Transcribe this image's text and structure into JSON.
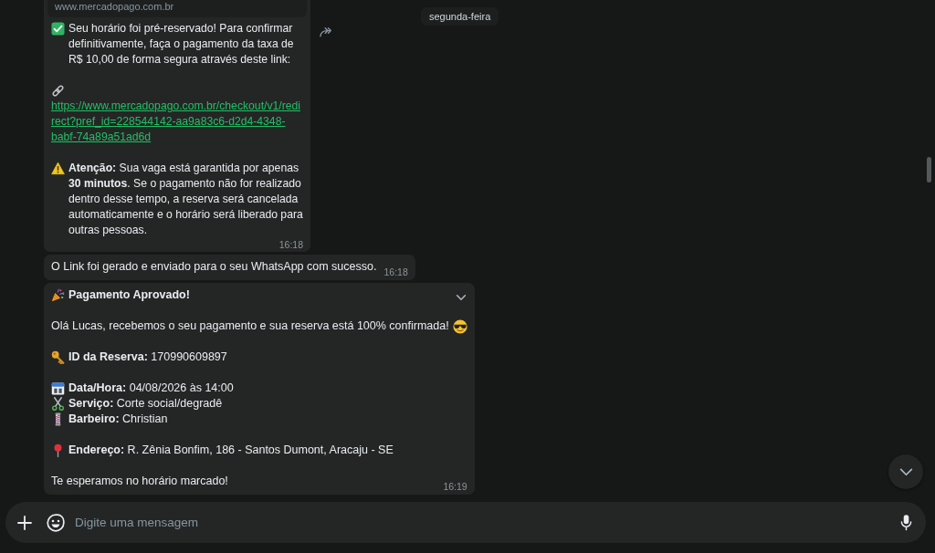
{
  "date_chip": {
    "label": "segunda-feira"
  },
  "messages": [
    {
      "kind": "link_preview",
      "hovered": false,
      "preview": {
        "domain": "www.mercadopago.com.br"
      },
      "paragraphs": [
        [
          {
            "kind": "confirmed",
            "text": "Seu horário foi pré-reservado! Para confirmar definitivamente, faça o pagamento da taxa de R$ 10,00 de forma segura através deste link:"
          }
        ],
        [
          {
            "kind": "link",
            "text": "https://www.mercadopago.com.br/checkout/v1/redirect?pref_id=228544142-aa9a83c6-d2d4-4348-babf-74a89a51ad6d"
          }
        ],
        [
          {
            "kind": "warning",
            "text": "**Atenção:** Sua vaga está garantida por apenas **30 minutos**. Se o pagamento não for realizado dentro desse tempo, a reserva será cancelada automaticamente e o horário será liberado para outras pessoas."
          }
        ]
      ],
      "time": "16:18"
    },
    {
      "kind": "text",
      "hovered": false,
      "paragraphs": [
        [
          {
            "kind": "text",
            "text": "O Link foi gerado e enviado para o seu WhatsApp com sucesso."
          }
        ]
      ],
      "time": "16:18"
    },
    {
      "kind": "text",
      "hovered": true,
      "paragraphs": [
        [
          {
            "kind": "heading",
            "text": "Pagamento Aprovado!"
          }
        ],
        [
          {
            "kind": "greeting",
            "text": "Olá Lucas, recebemos o seu pagamento e sua reserva está 100% confirmada!"
          }
        ],
        [
          {
            "kind": "reservation_id",
            "text": "**ID da Reserva:** 170990609897"
          }
        ],
        [
          {
            "kind": "date",
            "text": "**Data/Hora:** 04/08/2026 às 14:00"
          },
          {
            "kind": "service",
            "text": "**Serviço:** Corte social/degradê"
          },
          {
            "kind": "barber",
            "text": "**Barbeiro:** Christian"
          }
        ],
        [
          {
            "kind": "address",
            "text": "**Endereço:** R. Zênia Bonfim, 186 - Santos Dumont, Aracaju - SE"
          }
        ],
        [
          {
            "kind": "text",
            "text": "Te esperamos no horário marcado!"
          }
        ]
      ],
      "time": "16:19"
    }
  ],
  "composer": {
    "placeholder": "Digite uma mensagem"
  }
}
